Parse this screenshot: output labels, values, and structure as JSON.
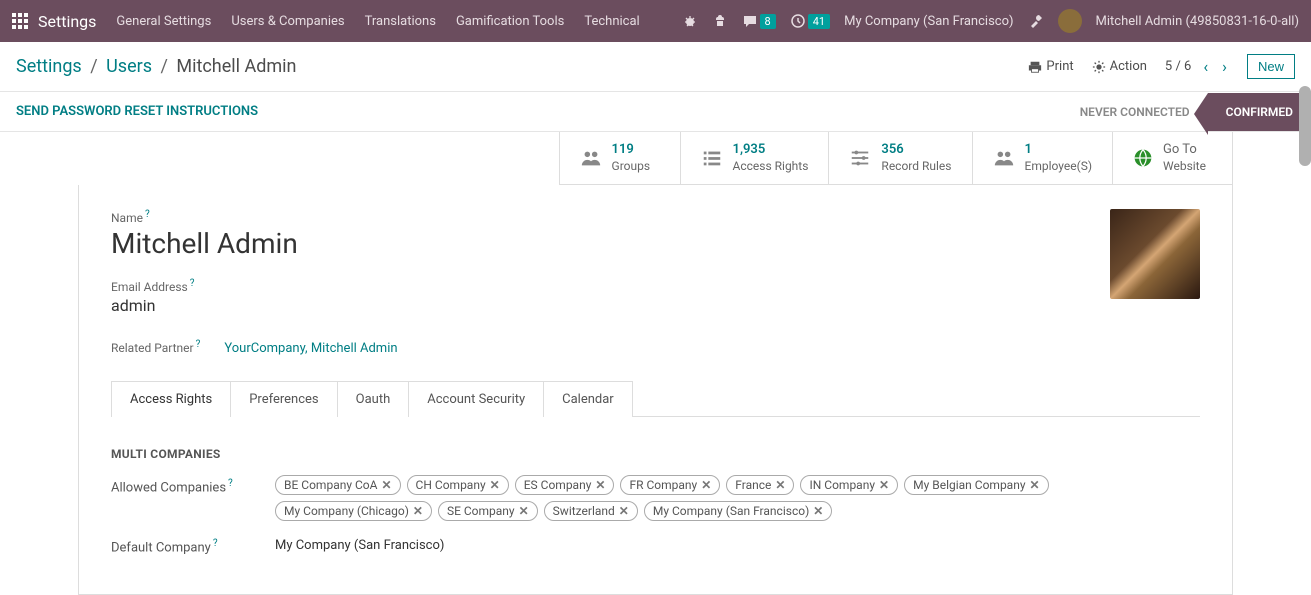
{
  "topnav": {
    "brand": "Settings",
    "menu": [
      "General Settings",
      "Users & Companies",
      "Translations",
      "Gamification Tools",
      "Technical"
    ],
    "messages_badge": "8",
    "activities_badge": "41",
    "company": "My Company (San Francisco)",
    "user": "Mitchell Admin (49850831-16-0-all)"
  },
  "breadcrumb": {
    "root": "Settings",
    "mid": "Users",
    "current": "Mitchell Admin"
  },
  "actions": {
    "print": "Print",
    "action": "Action",
    "pager": "5 / 6",
    "new": "New"
  },
  "status": {
    "reset_link": "SEND PASSWORD RESET INSTRUCTIONS",
    "never": "NEVER CONNECTED",
    "confirmed": "CONFIRMED"
  },
  "stats": [
    {
      "num": "119",
      "label": "Groups"
    },
    {
      "num": "1,935",
      "label": "Access Rights"
    },
    {
      "num": "356",
      "label": "Record Rules"
    },
    {
      "num": "1",
      "label": "Employee(S)"
    },
    {
      "num": "Go To",
      "label": "Website"
    }
  ],
  "form": {
    "name_label": "Name",
    "name_value": "Mitchell Admin",
    "email_label": "Email Address",
    "email_value": "admin",
    "related_label": "Related Partner",
    "related_value": "YourCompany, Mitchell Admin"
  },
  "tabs": [
    "Access Rights",
    "Preferences",
    "Oauth",
    "Account Security",
    "Calendar"
  ],
  "section": {
    "multi": "MULTI COMPANIES",
    "allowed_label": "Allowed Companies",
    "allowed": [
      "BE Company CoA",
      "CH Company",
      "ES Company",
      "FR Company",
      "France",
      "IN Company",
      "My Belgian Company",
      "My Company (Chicago)",
      "SE Company",
      "Switzerland",
      "My Company (San Francisco)"
    ],
    "default_label": "Default Company",
    "default_value": "My Company (San Francisco)"
  }
}
